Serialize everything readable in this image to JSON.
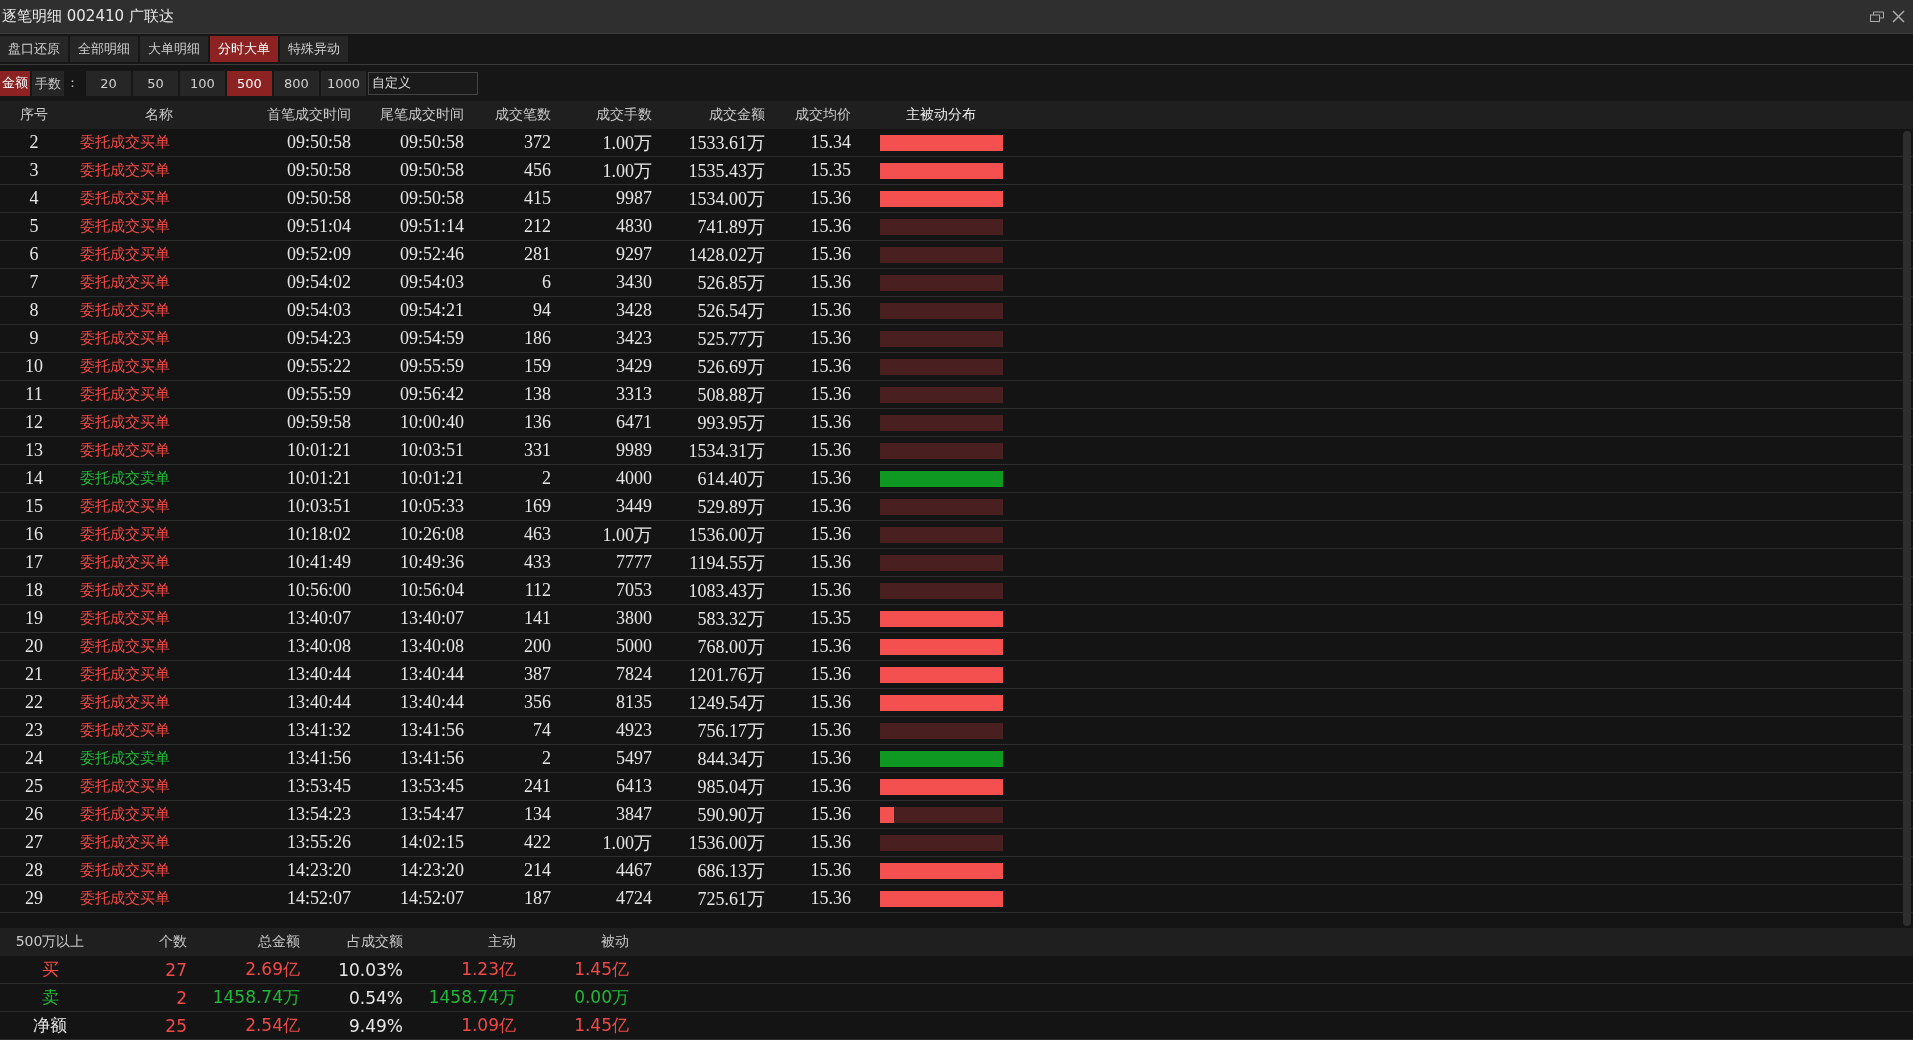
{
  "window": {
    "title": "逐笔明细 002410 广联达"
  },
  "tabs": [
    {
      "label": "盘口还原",
      "selected": false
    },
    {
      "label": "全部明细",
      "selected": false
    },
    {
      "label": "大单明细",
      "selected": false
    },
    {
      "label": "分时大单",
      "selected": true
    },
    {
      "label": "特殊异动",
      "selected": false
    }
  ],
  "filter": {
    "amount_label": "金额",
    "amount_selected": true,
    "lots_label": "手数",
    "colon": "：",
    "options": [
      {
        "label": "20",
        "selected": false
      },
      {
        "label": "50",
        "selected": false
      },
      {
        "label": "100",
        "selected": false
      },
      {
        "label": "500",
        "selected": true
      },
      {
        "label": "800",
        "selected": false
      },
      {
        "label": "1000",
        "selected": false
      }
    ],
    "custom": {
      "value": "自定义"
    }
  },
  "table": {
    "columns": [
      "序号",
      "名称",
      "首笔成交时间",
      "尾笔成交时间",
      "成交笔数",
      "成交手数",
      "成交金额",
      "成交均价",
      "主被动分布"
    ],
    "rows": [
      {
        "no": "2",
        "name": "委托成交买单",
        "kind": "buy",
        "first": "09:50:58",
        "last": "09:50:58",
        "count": "372",
        "lots": "1.00万",
        "amount": "1533.61万",
        "avg": "15.34",
        "level": 1
      },
      {
        "no": "3",
        "name": "委托成交买单",
        "kind": "buy",
        "first": "09:50:58",
        "last": "09:50:58",
        "count": "456",
        "lots": "1.00万",
        "amount": "1535.43万",
        "avg": "15.35",
        "level": 1
      },
      {
        "no": "4",
        "name": "委托成交买单",
        "kind": "buy",
        "first": "09:50:58",
        "last": "09:50:58",
        "count": "415",
        "lots": "9987",
        "amount": "1534.00万",
        "avg": "15.36",
        "level": 1
      },
      {
        "no": "5",
        "name": "委托成交买单",
        "kind": "buy",
        "first": "09:51:04",
        "last": "09:51:14",
        "count": "212",
        "lots": "4830",
        "amount": "741.89万",
        "avg": "15.36",
        "level": 0
      },
      {
        "no": "6",
        "name": "委托成交买单",
        "kind": "buy",
        "first": "09:52:09",
        "last": "09:52:46",
        "count": "281",
        "lots": "9297",
        "amount": "1428.02万",
        "avg": "15.36",
        "level": 0
      },
      {
        "no": "7",
        "name": "委托成交买单",
        "kind": "buy",
        "first": "09:54:02",
        "last": "09:54:03",
        "count": "6",
        "lots": "3430",
        "amount": "526.85万",
        "avg": "15.36",
        "level": 0
      },
      {
        "no": "8",
        "name": "委托成交买单",
        "kind": "buy",
        "first": "09:54:03",
        "last": "09:54:21",
        "count": "94",
        "lots": "3428",
        "amount": "526.54万",
        "avg": "15.36",
        "level": 0
      },
      {
        "no": "9",
        "name": "委托成交买单",
        "kind": "buy",
        "first": "09:54:23",
        "last": "09:54:59",
        "count": "186",
        "lots": "3423",
        "amount": "525.77万",
        "avg": "15.36",
        "level": 0
      },
      {
        "no": "10",
        "name": "委托成交买单",
        "kind": "buy",
        "first": "09:55:22",
        "last": "09:55:59",
        "count": "159",
        "lots": "3429",
        "amount": "526.69万",
        "avg": "15.36",
        "level": 0
      },
      {
        "no": "11",
        "name": "委托成交买单",
        "kind": "buy",
        "first": "09:55:59",
        "last": "09:56:42",
        "count": "138",
        "lots": "3313",
        "amount": "508.88万",
        "avg": "15.36",
        "level": 0
      },
      {
        "no": "12",
        "name": "委托成交买单",
        "kind": "buy",
        "first": "09:59:58",
        "last": "10:00:40",
        "count": "136",
        "lots": "6471",
        "amount": "993.95万",
        "avg": "15.36",
        "level": 0
      },
      {
        "no": "13",
        "name": "委托成交买单",
        "kind": "buy",
        "first": "10:01:21",
        "last": "10:03:51",
        "count": "331",
        "lots": "9989",
        "amount": "1534.31万",
        "avg": "15.36",
        "level": 0
      },
      {
        "no": "14",
        "name": "委托成交卖单",
        "kind": "sell",
        "first": "10:01:21",
        "last": "10:01:21",
        "count": "2",
        "lots": "4000",
        "amount": "614.40万",
        "avg": "15.36",
        "level": 1
      },
      {
        "no": "15",
        "name": "委托成交买单",
        "kind": "buy",
        "first": "10:03:51",
        "last": "10:05:33",
        "count": "169",
        "lots": "3449",
        "amount": "529.89万",
        "avg": "15.36",
        "level": 0
      },
      {
        "no": "16",
        "name": "委托成交买单",
        "kind": "buy",
        "first": "10:18:02",
        "last": "10:26:08",
        "count": "463",
        "lots": "1.00万",
        "amount": "1536.00万",
        "avg": "15.36",
        "level": 0
      },
      {
        "no": "17",
        "name": "委托成交买单",
        "kind": "buy",
        "first": "10:41:49",
        "last": "10:49:36",
        "count": "433",
        "lots": "7777",
        "amount": "1194.55万",
        "avg": "15.36",
        "level": 0
      },
      {
        "no": "18",
        "name": "委托成交买单",
        "kind": "buy",
        "first": "10:56:00",
        "last": "10:56:04",
        "count": "112",
        "lots": "7053",
        "amount": "1083.43万",
        "avg": "15.36",
        "level": 0
      },
      {
        "no": "19",
        "name": "委托成交买单",
        "kind": "buy",
        "first": "13:40:07",
        "last": "13:40:07",
        "count": "141",
        "lots": "3800",
        "amount": "583.32万",
        "avg": "15.35",
        "level": 1
      },
      {
        "no": "20",
        "name": "委托成交买单",
        "kind": "buy",
        "first": "13:40:08",
        "last": "13:40:08",
        "count": "200",
        "lots": "5000",
        "amount": "768.00万",
        "avg": "15.36",
        "level": 1
      },
      {
        "no": "21",
        "name": "委托成交买单",
        "kind": "buy",
        "first": "13:40:44",
        "last": "13:40:44",
        "count": "387",
        "lots": "7824",
        "amount": "1201.76万",
        "avg": "15.36",
        "level": 1
      },
      {
        "no": "22",
        "name": "委托成交买单",
        "kind": "buy",
        "first": "13:40:44",
        "last": "13:40:44",
        "count": "356",
        "lots": "8135",
        "amount": "1249.54万",
        "avg": "15.36",
        "level": 1
      },
      {
        "no": "23",
        "name": "委托成交买单",
        "kind": "buy",
        "first": "13:41:32",
        "last": "13:41:56",
        "count": "74",
        "lots": "4923",
        "amount": "756.17万",
        "avg": "15.36",
        "level": 0
      },
      {
        "no": "24",
        "name": "委托成交卖单",
        "kind": "sell",
        "first": "13:41:56",
        "last": "13:41:56",
        "count": "2",
        "lots": "5497",
        "amount": "844.34万",
        "avg": "15.36",
        "level": 1
      },
      {
        "no": "25",
        "name": "委托成交买单",
        "kind": "buy",
        "first": "13:53:45",
        "last": "13:53:45",
        "count": "241",
        "lots": "6413",
        "amount": "985.04万",
        "avg": "15.36",
        "level": 1
      },
      {
        "no": "26",
        "name": "委托成交买单",
        "kind": "buy",
        "first": "13:54:23",
        "last": "13:54:47",
        "count": "134",
        "lots": "3847",
        "amount": "590.90万",
        "avg": "15.36",
        "level": 0.12
      },
      {
        "no": "27",
        "name": "委托成交买单",
        "kind": "buy",
        "first": "13:55:26",
        "last": "14:02:15",
        "count": "422",
        "lots": "1.00万",
        "amount": "1536.00万",
        "avg": "15.36",
        "level": 0
      },
      {
        "no": "28",
        "name": "委托成交买单",
        "kind": "buy",
        "first": "14:23:20",
        "last": "14:23:20",
        "count": "214",
        "lots": "4467",
        "amount": "686.13万",
        "avg": "15.36",
        "level": 1
      },
      {
        "no": "29",
        "name": "委托成交买单",
        "kind": "buy",
        "first": "14:52:07",
        "last": "14:52:07",
        "count": "187",
        "lots": "4724",
        "amount": "725.61万",
        "avg": "15.36",
        "level": 1
      }
    ]
  },
  "summary": {
    "columns": [
      "500万以上",
      "个数",
      "总金额",
      "占成交额",
      "主动",
      "被动"
    ],
    "rows": [
      {
        "kind": "buy",
        "label": "买",
        "count": "27",
        "total": "2.69亿",
        "share": "10.03%",
        "active": "1.23亿",
        "passive": "1.45亿"
      },
      {
        "kind": "sell",
        "label": "卖",
        "count": "2",
        "total": "1458.74万",
        "share": "0.54%",
        "active": "1458.74万",
        "passive": "0.00万"
      },
      {
        "kind": "net",
        "label": "净额",
        "count": "25",
        "total": "2.54亿",
        "share": "9.49%",
        "active": "1.09亿",
        "passive": "1.45亿"
      }
    ]
  }
}
